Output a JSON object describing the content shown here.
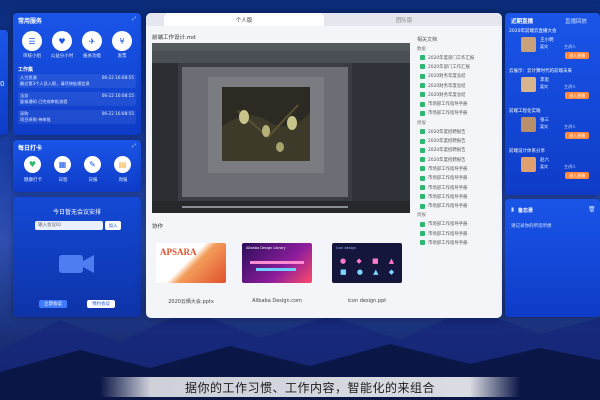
{
  "left_edge": {
    "clock": "0"
  },
  "services": {
    "title": "常用服务",
    "items": [
      {
        "label": "审核小组"
      },
      {
        "label": "公益分小时"
      },
      {
        "label": "报关功能"
      },
      {
        "label": "发票"
      }
    ],
    "tasks_title": "工作集",
    "tasks": [
      {
        "who": "人力资源",
        "time": "06-22 16:08:55",
        "text": "最近第3个人员入职，请尽快处理信息"
      },
      {
        "who": "法务",
        "time": "06-22 16:08:55",
        "text": "复核通知 已完成审批流程"
      },
      {
        "who": "采购",
        "time": "06-22 16:08:55",
        "text": "项目采购 待审批"
      }
    ]
  },
  "checkin": {
    "title": "每日打卡",
    "items": [
      {
        "label": "健康打卡"
      },
      {
        "label": "日程"
      },
      {
        "label": "日报"
      },
      {
        "label": "周报"
      }
    ]
  },
  "meeting": {
    "title": "今日暂无会议安排",
    "input_placeholder": "输入会议ID",
    "join_label": "加入",
    "start_label": "立即会议",
    "book_label": "预约会议"
  },
  "center": {
    "tab_active": "个人版",
    "tab_inactive": "团队版",
    "doc_title": "前端工作设计.md",
    "section_title": "协作",
    "thumbs": [
      {
        "caption": "2020云栖大会.pptx",
        "banner": "APSARA"
      },
      {
        "caption": "Alibaba Design.com",
        "banner": "Alibaba Design Library"
      },
      {
        "caption": "icon design.ppt",
        "banner": "icon design"
      }
    ],
    "related_title": "相关文档",
    "related_groups": [
      {
        "head": "数据",
        "items": [
          "2020年度部门工作汇报",
          "2020年部门工作汇报",
          "2020财务年度总结",
          "2020财务年度总结",
          "2020财务年度总结",
          "市场部工作指导手册",
          "市场部工作指导手册"
        ]
      },
      {
        "head": "周报",
        "items": [
          "2020年度招聘报告",
          "2020年度招聘报告",
          "2020年度招聘报告",
          "2020年度招聘报告",
          "市场部工作指导手册",
          "市场部工作指导手册",
          "市场部工作指导手册",
          "市场部工作指导手册",
          "市场部工作指导手册"
        ]
      },
      {
        "head": "周报",
        "items": [
          "市场部工作指导手册",
          "市场部工作指导手册",
          "市场部工作指导手册"
        ]
      }
    ]
  },
  "right": {
    "tab1": "近期直播",
    "tab2": "直播回放",
    "items": [
      {
        "title": "2020年前端云直播大会",
        "host": "王小明",
        "sub1": "嘉宾",
        "sub2": "主讲人",
        "btn": "进入直播"
      },
      {
        "title": "云展示：云计算时代的前端未来",
        "host": "李思",
        "sub1": "嘉宾",
        "sub2": "主讲人",
        "btn": "进入直播"
      },
      {
        "title": "前端工程化实践",
        "host": "张三",
        "sub1": "嘉宾",
        "sub2": "主讲人",
        "btn": "进入直播"
      },
      {
        "title": "前端设计体系分享",
        "host": "赵六",
        "sub1": "嘉宾",
        "sub2": "主讲人",
        "btn": "进入直播"
      }
    ],
    "notes_title": "备忘录",
    "notes_placeholder": "请记录你的所思所想"
  },
  "caption": "据你的工作习惯、工作内容，智能化的来组合"
}
